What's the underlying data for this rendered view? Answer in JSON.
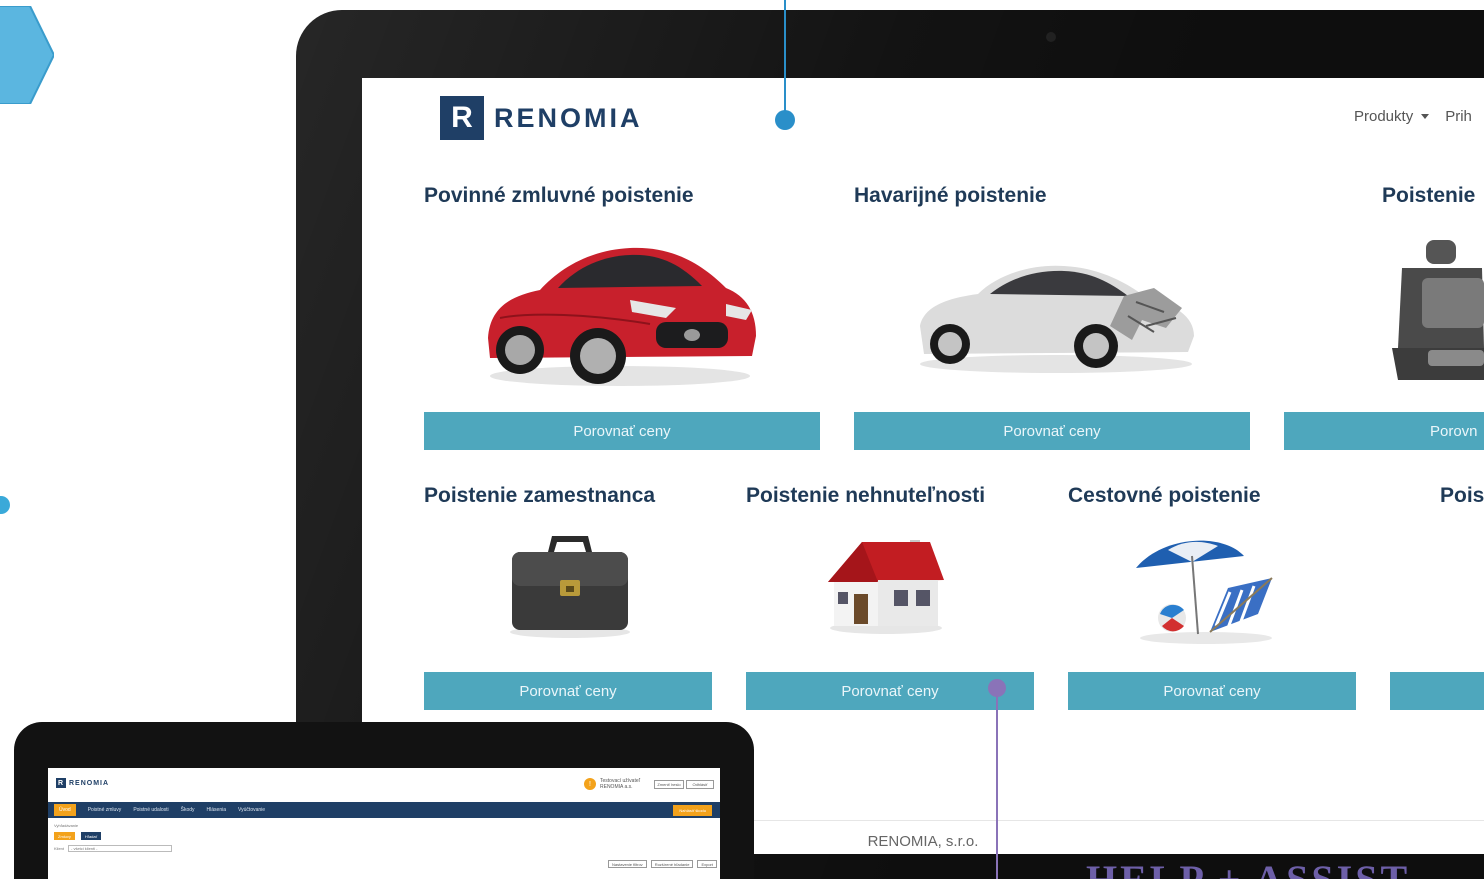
{
  "brand": {
    "logo_letter": "R",
    "name": "RENOMIA"
  },
  "nav": {
    "products": "Produkty",
    "login_partial": "Prih"
  },
  "cards": [
    {
      "title": "Povinné zmluvné poistenie",
      "button": "Porovnať ceny",
      "image": "red-car"
    },
    {
      "title": "Havarijné poistenie",
      "button": "Porovnať ceny",
      "image": "crashed-car"
    },
    {
      "title": "Poistenie",
      "button": "Porovn",
      "image": "car-seats"
    },
    {
      "title": "Poistenie zamestnanca",
      "button": "Porovnať ceny",
      "image": "briefcase"
    },
    {
      "title": "Poistenie nehnuteľnosti",
      "button": "Porovnať ceny",
      "image": "house"
    },
    {
      "title": "Cestovné poistenie",
      "button": "Porovnať ceny",
      "image": "beach-umbrella"
    },
    {
      "title": "Pois",
      "button": "",
      "image": "none"
    }
  ],
  "footer": {
    "text": "RENOMIA, s.r.o."
  },
  "overlay": {
    "help_text": "HELP + ASSIST"
  },
  "laptop": {
    "brand": "RENOMIA",
    "user_line1": "Testovací užívateľ",
    "user_line2": "RENOMIA a.s.",
    "user_btn1": "Zmeniť heslo",
    "user_btn2": "Odhlásiť",
    "nav": [
      "Úvod",
      "Poistné zmluvy",
      "Poistné udalosti",
      "Škody",
      "Hlásenia",
      "Vyúčtovanie"
    ],
    "nav_cta": "Nahlásiť škodu",
    "filters_label": "Vyhľadávanie",
    "chip1": "Zmluvy",
    "chip2": "Hľadať",
    "select_label": "Klient",
    "select_value": "- všetci klienti -",
    "actions": [
      "Nastavenie filtrov",
      "Rozšírené hľadanie",
      "Export"
    ]
  },
  "colors": {
    "brand_navy": "#1f3f66",
    "cta_teal": "#4ea7bd",
    "pin_blue": "#2a8fc9",
    "pin_purple": "#8a73b8",
    "accent_orange": "#f3a21b"
  }
}
